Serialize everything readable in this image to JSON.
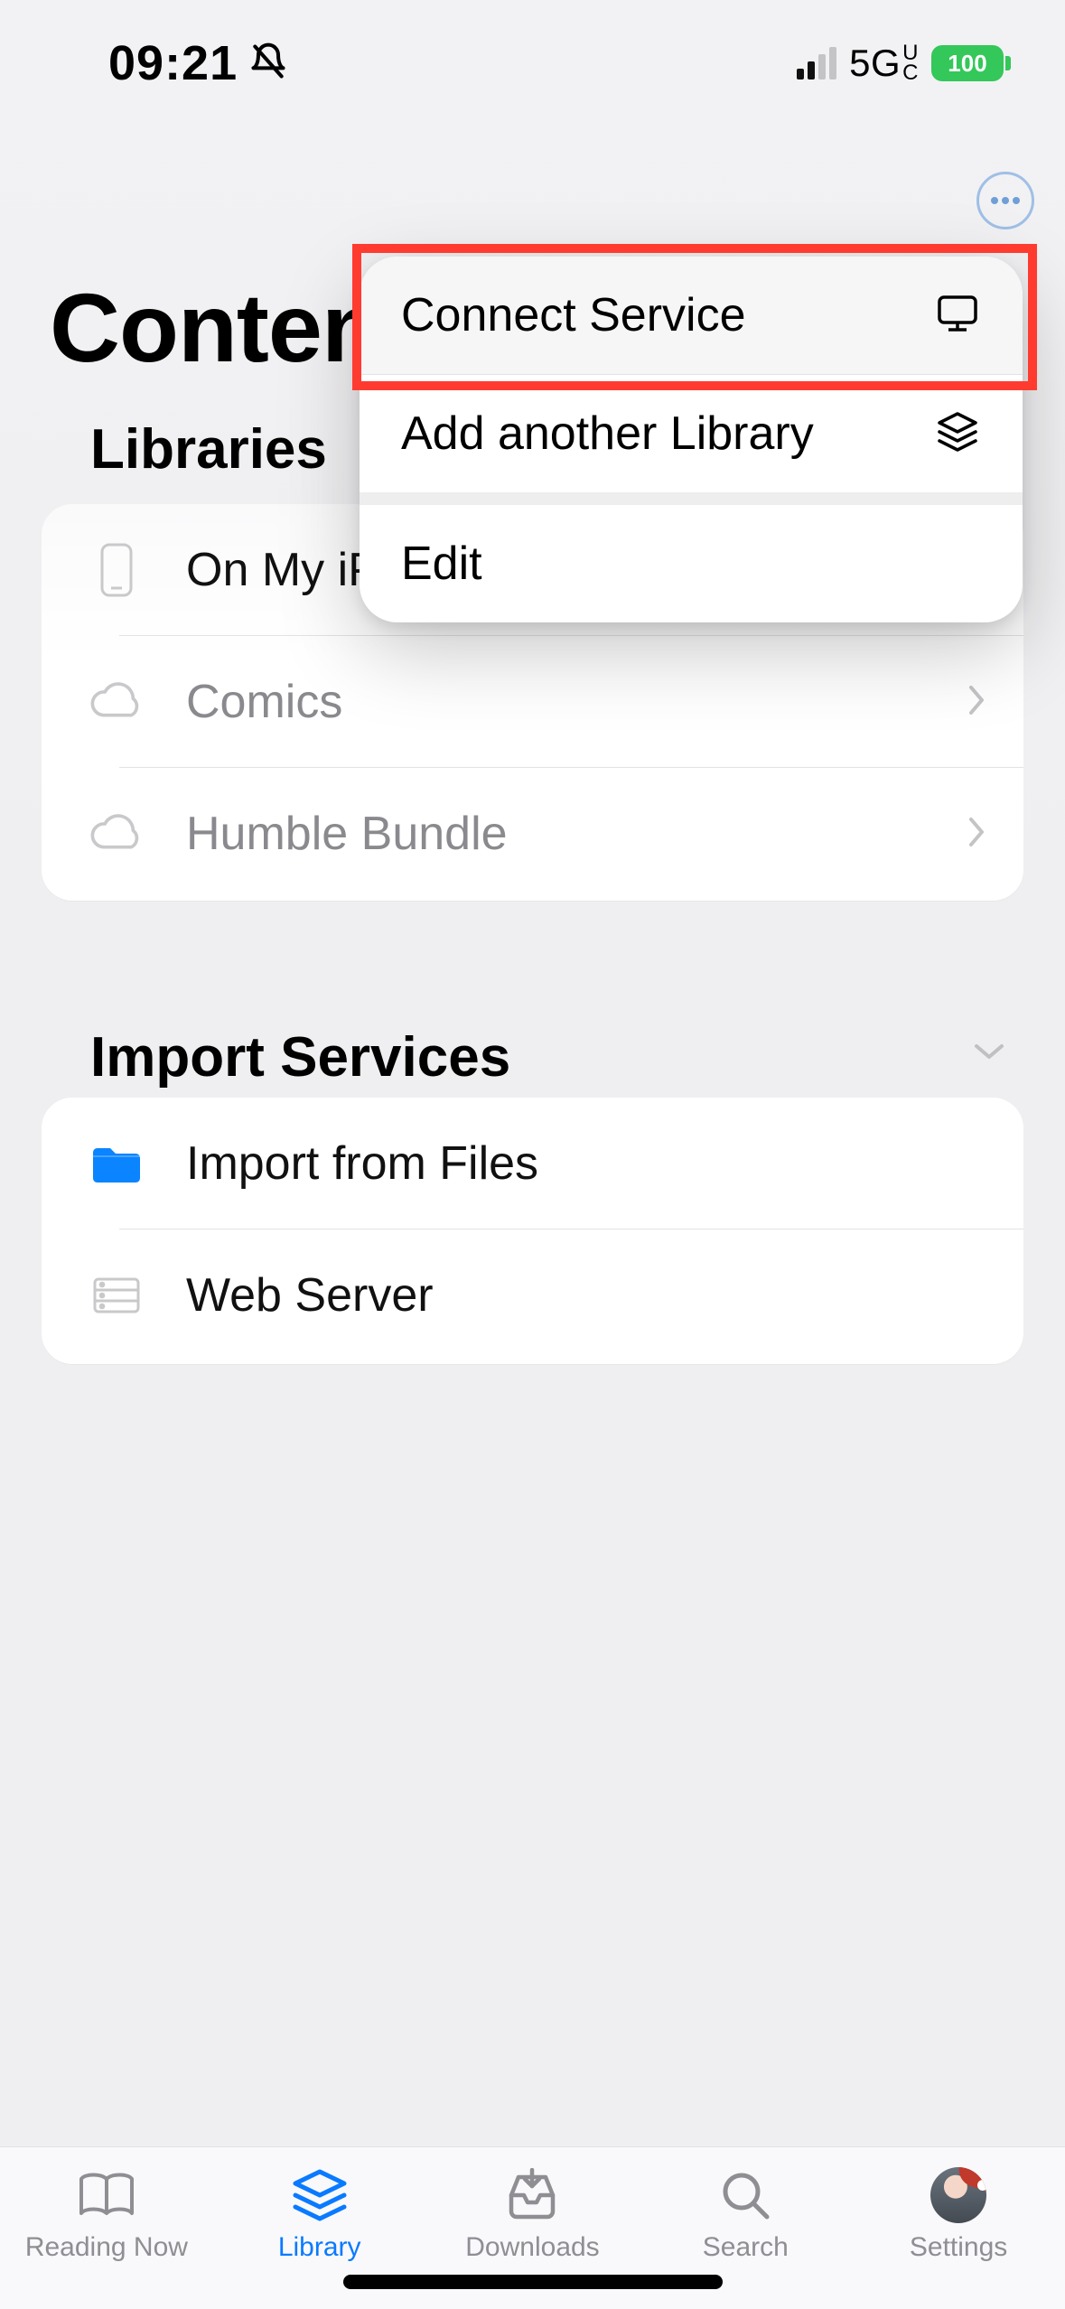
{
  "status": {
    "time": "09:21",
    "silent": true,
    "signal_bars_active": 2,
    "network": "5G",
    "network_suffix_top": "U",
    "network_suffix_bottom": "C",
    "battery_percent": "100"
  },
  "header": {
    "title": "Content"
  },
  "popup": {
    "items": [
      {
        "label": "Connect Service",
        "icon": "monitor-icon"
      },
      {
        "label": "Add another Library",
        "icon": "stack-icon"
      },
      {
        "label": "Edit",
        "icon": ""
      }
    ]
  },
  "sections": {
    "libraries_title": "Libraries",
    "import_title": "Import Services"
  },
  "libraries": [
    {
      "label": "On My iPhone",
      "icon": "device-icon",
      "dim": false,
      "chevron": false
    },
    {
      "label": "Comics",
      "icon": "cloud-icon",
      "dim": true,
      "chevron": true
    },
    {
      "label": "Humble Bundle",
      "icon": "cloud-icon",
      "dim": true,
      "chevron": true
    }
  ],
  "import_services": [
    {
      "label": "Import from Files",
      "icon": "folder-icon"
    },
    {
      "label": "Web Server",
      "icon": "server-icon"
    }
  ],
  "tabs": [
    {
      "label": "Reading Now",
      "icon": "book-icon",
      "active": false
    },
    {
      "label": "Library",
      "icon": "stack-icon",
      "active": true
    },
    {
      "label": "Downloads",
      "icon": "inbox-icon",
      "active": false
    },
    {
      "label": "Search",
      "icon": "search-icon",
      "active": false
    },
    {
      "label": "Settings",
      "icon": "avatar-icon",
      "active": false
    }
  ]
}
